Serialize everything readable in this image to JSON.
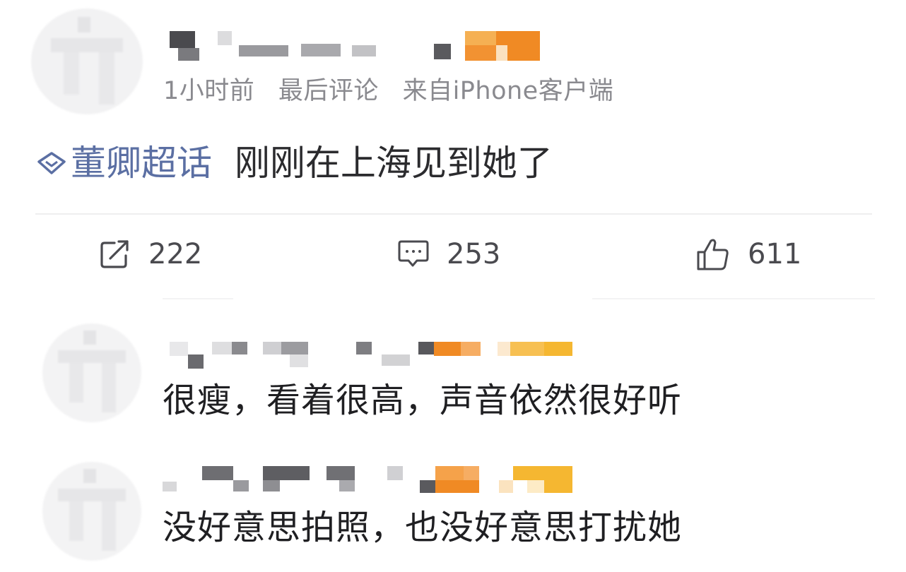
{
  "post": {
    "meta": {
      "time": "1小时前",
      "last_comment": "最后评论",
      "source": "来自iPhone客户端"
    },
    "topic_name": "董卿超话",
    "text": "刚刚在上海见到她了",
    "actions": {
      "repost_count": "222",
      "comment_count": "253",
      "like_count": "611"
    }
  },
  "comments": [
    {
      "text": "很瘦，看着很高，声音依然很好听"
    },
    {
      "text": "没好意思拍照，也没好意思打扰她"
    }
  ],
  "colors": {
    "topic": "#5b6fa3",
    "meta": "#8a8a8f",
    "badge_orange": "#f08a24",
    "badge_gold": "#f5b731",
    "mosaic_gray": "#5f5f63"
  },
  "icons": {
    "topic": "diamond-topic-icon",
    "repost": "repost-icon",
    "comment": "comment-icon",
    "like": "thumbs-up-icon"
  }
}
